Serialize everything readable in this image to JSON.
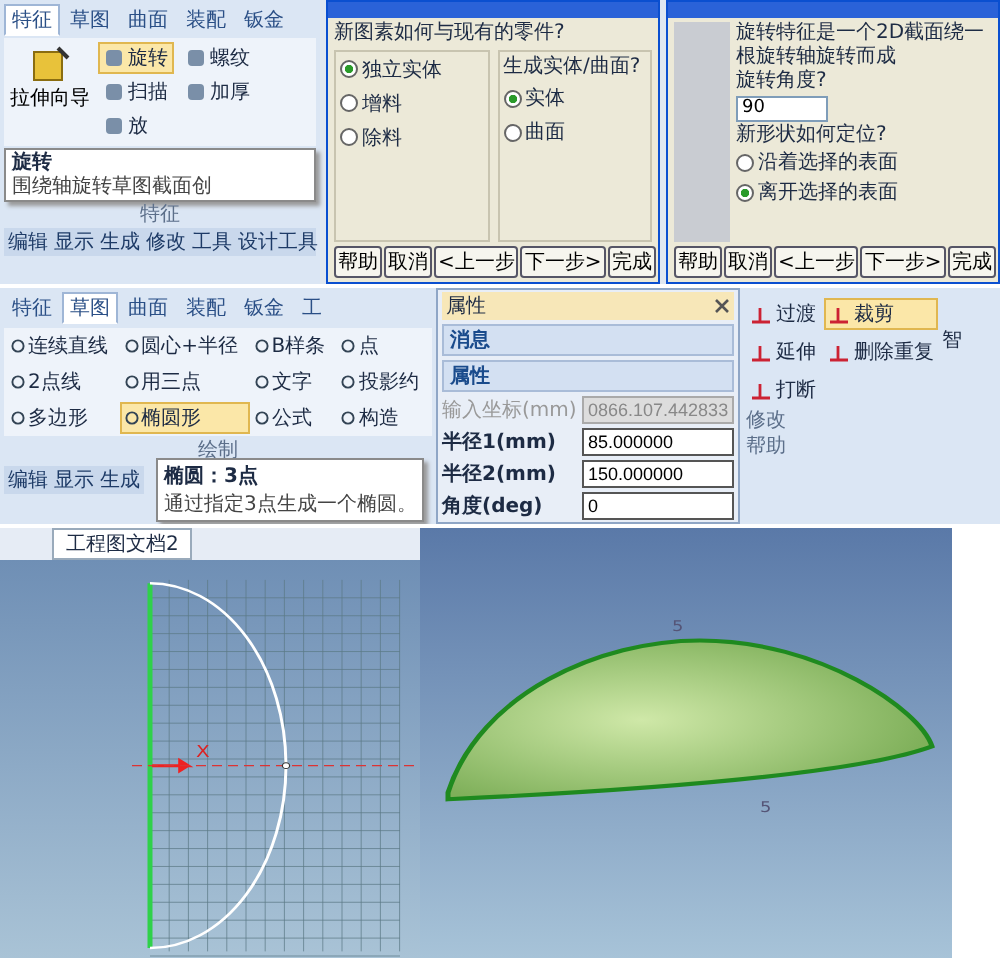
{
  "feature_ribbon": {
    "tabs": [
      {
        "label": "特征",
        "selected": true
      },
      {
        "label": "草图",
        "selected": false
      },
      {
        "label": "曲面",
        "selected": false
      },
      {
        "label": "装配",
        "selected": false
      },
      {
        "label": "钣金",
        "selected": false
      }
    ],
    "big_tool": "拉伸向导",
    "tool_columns": [
      [
        {
          "label": "旋转",
          "selected": true
        },
        {
          "label": "扫描",
          "selected": false
        },
        {
          "label": "放",
          "selected": false
        }
      ],
      [
        {
          "label": "螺纹",
          "selected": false
        },
        {
          "label": "加厚",
          "selected": false
        }
      ]
    ],
    "tooltip": {
      "title": "旋转",
      "text": "围绕轴旋转草图截面创"
    },
    "group_label": "特征",
    "bottom_tabs": [
      "编辑",
      "显示",
      "生成",
      "修改",
      "工具",
      "设计工具"
    ]
  },
  "solid_dialog": {
    "question": "新图素如何与现有的零件?",
    "part_options": [
      {
        "label": "独立实体",
        "selected": true
      },
      {
        "label": "增料",
        "selected": false
      },
      {
        "label": "除料",
        "selected": false
      }
    ],
    "type_question": "生成实体/曲面?",
    "type_options": [
      {
        "label": "实体",
        "selected": true
      },
      {
        "label": "曲面",
        "selected": false
      }
    ],
    "buttons": [
      "帮助",
      "取消",
      "<上一步",
      "下一步>",
      "完成"
    ]
  },
  "revolve_dialog": {
    "description": "旋转特征是一个2D截面绕一根旋转轴旋转而成",
    "angle_label": "旋转角度?",
    "angle_value": "90",
    "position_question": "新形状如何定位?",
    "position_options": [
      {
        "label": "沿着选择的表面",
        "selected": false
      },
      {
        "label": "离开选择的表面",
        "selected": true
      }
    ],
    "buttons": [
      "帮助",
      "取消",
      "<上一步",
      "下一步>",
      "完成"
    ]
  },
  "sketch_ribbon": {
    "tabs": [
      {
        "label": "特征",
        "selected": false
      },
      {
        "label": "草图",
        "selected": true
      },
      {
        "label": "曲面",
        "selected": false
      },
      {
        "label": "装配",
        "selected": false
      },
      {
        "label": "钣金",
        "selected": false
      },
      {
        "label": "工",
        "selected": false
      }
    ],
    "tools": [
      {
        "label": "连续直线",
        "selected": false
      },
      {
        "label": "圆心+半径",
        "selected": false
      },
      {
        "label": "B样条",
        "selected": false
      },
      {
        "label": "点",
        "selected": false
      },
      {
        "label": "2点线",
        "selected": false
      },
      {
        "label": "用三点",
        "selected": false
      },
      {
        "label": "文字",
        "selected": false
      },
      {
        "label": "投影约",
        "selected": false
      },
      {
        "label": "多边形",
        "selected": false
      },
      {
        "label": "椭圆形",
        "selected": true
      },
      {
        "label": "公式",
        "selected": false
      },
      {
        "label": "构造",
        "selected": false
      }
    ],
    "group_label": "绘制",
    "bottom_tabs": [
      "编辑",
      "显示",
      "生成"
    ],
    "tooltip": {
      "title": "椭圆：3点",
      "text": "通过指定3点生成一个椭圆。"
    }
  },
  "properties": {
    "title": "属性",
    "sections": [
      "消息",
      "属性"
    ],
    "fields": [
      {
        "label": "输入坐标(mm)",
        "value": "0866.107.442833",
        "disabled": true
      },
      {
        "label": "半径1(mm)",
        "value": "85.000000",
        "disabled": false
      },
      {
        "label": "半径2(mm)",
        "value": "150.000000",
        "disabled": false
      },
      {
        "label": "角度(deg)",
        "value": "0",
        "disabled": false
      }
    ]
  },
  "modify_ribbon": {
    "tools": [
      {
        "label": "过渡",
        "selected": false
      },
      {
        "label": "裁剪",
        "selected": true
      },
      {
        "label": "延伸",
        "selected": false
      },
      {
        "label": "删除重复",
        "selected": false
      },
      {
        "label": "打断",
        "selected": false
      }
    ],
    "group_label": "修改",
    "cut_label": "智",
    "next_group_label": "帮助"
  },
  "sketch_view": {
    "doc_tab": "工程图文档2",
    "axis_label": "X"
  },
  "model_view": {
    "dimension_labels": [
      "5",
      "5"
    ]
  }
}
